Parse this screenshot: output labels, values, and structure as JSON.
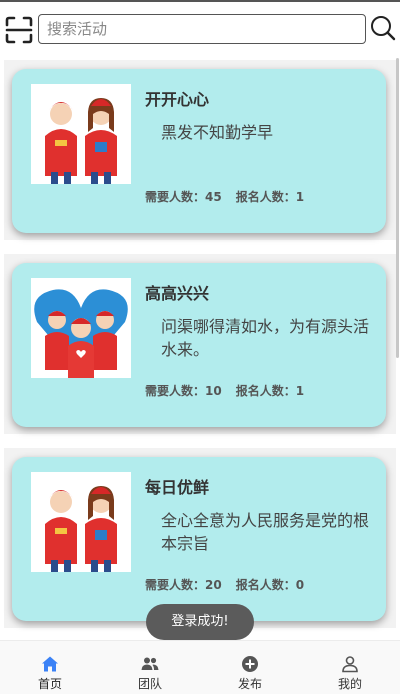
{
  "search": {
    "placeholder": "搜索活动",
    "scan_icon": "scan-icon",
    "search_icon": "search-icon"
  },
  "activities": [
    {
      "title": "开开心心",
      "description": "黑发不知勤学早",
      "required_label": "需要人数：",
      "required": "45",
      "signed_label": "报名人数：",
      "signed": "1"
    },
    {
      "title": "高高兴兴",
      "description": "问渠哪得清如水，为有源头活水来。",
      "required_label": "需要人数：",
      "required": "10",
      "signed_label": "报名人数：",
      "signed": "1"
    },
    {
      "title": "每日优鲜",
      "description": "全心全意为人民服务是党的根本宗旨",
      "required_label": "需要人数：",
      "required": "20",
      "signed_label": "报名人数：",
      "signed": "0"
    }
  ],
  "toast": {
    "text": "登录成功!"
  },
  "tabbar": {
    "items": [
      {
        "label": "首页",
        "icon": "home-icon",
        "active": true
      },
      {
        "label": "团队",
        "icon": "team-icon",
        "active": false
      },
      {
        "label": "发布",
        "icon": "publish-icon",
        "active": false
      },
      {
        "label": "我的",
        "icon": "profile-icon",
        "active": false
      }
    ]
  },
  "colors": {
    "card_bg": "#b2eced",
    "active_tab": "#3b82f6",
    "inactive_tab": "#555555"
  }
}
